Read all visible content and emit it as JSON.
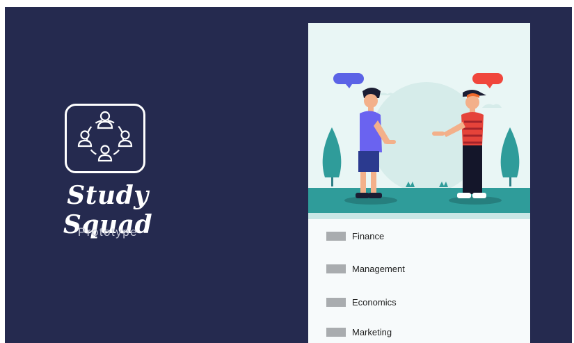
{
  "brand": {
    "title": "Study Squad",
    "subtitle": "Prototype"
  },
  "colors": {
    "background": "#252a4f",
    "panel": "#f7fafb",
    "hero_bg": "#e9f6f5",
    "ground": "#2f9c9a",
    "bubble_left": "#5b63e6",
    "bubble_right": "#f0463c"
  },
  "icons": {
    "logo": "group-circle-icon",
    "list_item": "placeholder-rect-icon"
  },
  "categories": [
    {
      "label": "Finance"
    },
    {
      "label": "Management"
    },
    {
      "label": "Economics"
    },
    {
      "label": "Marketing"
    }
  ]
}
